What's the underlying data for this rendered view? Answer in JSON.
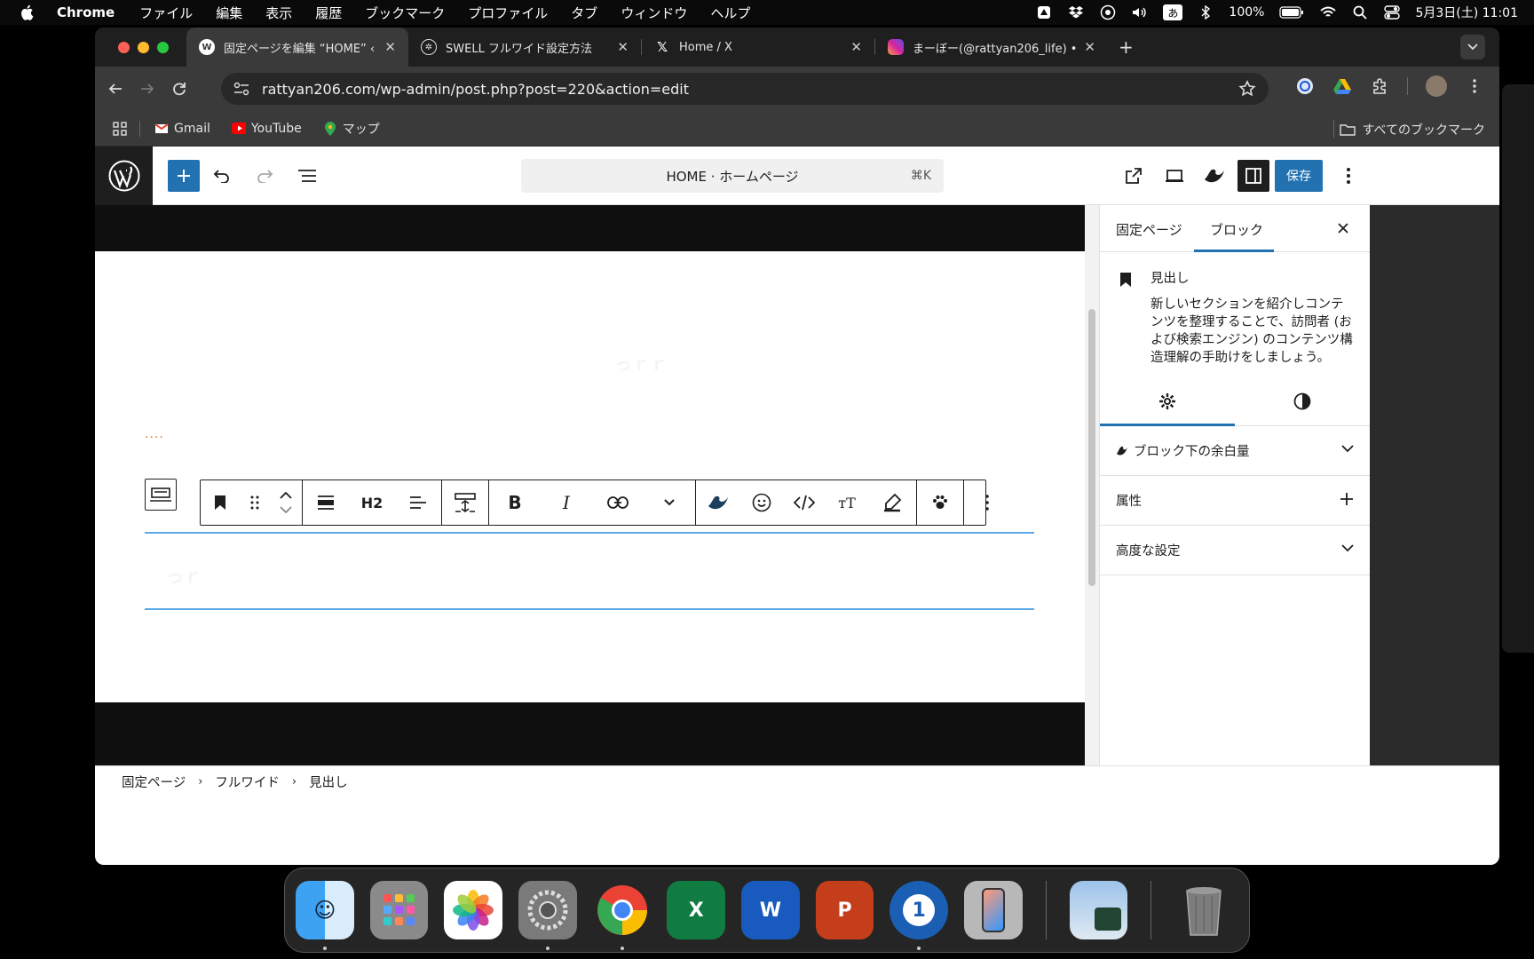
{
  "menubar": {
    "app_name": "Chrome",
    "items": [
      "ファイル",
      "編集",
      "表示",
      "履歴",
      "ブックマーク",
      "プロファイル",
      "タブ",
      "ウィンドウ",
      "ヘルプ"
    ],
    "battery": "100%",
    "datetime": "5月3日(土) 11:01",
    "ime": "あ"
  },
  "browser": {
    "tabs": [
      {
        "title": "固定ページを編集 “HOME” ‹ ラ",
        "icon": "wordpress-icon"
      },
      {
        "title": "SWELL フルワイド設定方法",
        "icon": "chatgpt-icon"
      },
      {
        "title": "Home / X",
        "icon": "x-icon"
      },
      {
        "title": "まーぼー(@rattyan206_life) •",
        "icon": "instagram-icon"
      }
    ],
    "url": "rattyan206.com/wp-admin/post.php?post=220&action=edit",
    "bookmarks": [
      {
        "label": "Gmail",
        "icon": "gmail-icon"
      },
      {
        "label": "YouTube",
        "icon": "youtube-icon"
      },
      {
        "label": "マップ",
        "icon": "maps-icon"
      }
    ],
    "all_bookmarks": "すべてのブックマーク"
  },
  "editor": {
    "doc_title": "HOME · ホームページ",
    "shortcut": "⌘K",
    "save_label": "保存",
    "block_toolbar": {
      "heading_level": "H2"
    },
    "canvas": {
      "ghost_text_1": "っｒｒ",
      "ghost_text_2": "っｒ",
      "dots": "...."
    }
  },
  "sidebar": {
    "tab_page": "固定ページ",
    "tab_block": "ブロック",
    "block_name": "見出し",
    "block_desc": "新しいセクションを紹介しコンテンツを整理することで、訪問者 (および検索エンジン) のコンテンツ構造理解の手助けをしましょう。",
    "panels": [
      {
        "label": "ブロック下の余白量",
        "toggle": "chevron"
      },
      {
        "label": "属性",
        "toggle": "plus"
      },
      {
        "label": "高度な設定",
        "toggle": "chevron"
      }
    ]
  },
  "breadcrumb": [
    "固定ページ",
    "フルワイド",
    "見出し"
  ],
  "dock": [
    "Finder",
    "Launchpad",
    "Photos",
    "System Settings",
    "Chrome",
    "Excel",
    "Word",
    "PowerPoint",
    "1Password",
    "iPhone Mirroring",
    "Preview",
    "Trash"
  ],
  "colors": {
    "wp_blue": "#2271b1",
    "heading_line": "#5aa9e6"
  }
}
